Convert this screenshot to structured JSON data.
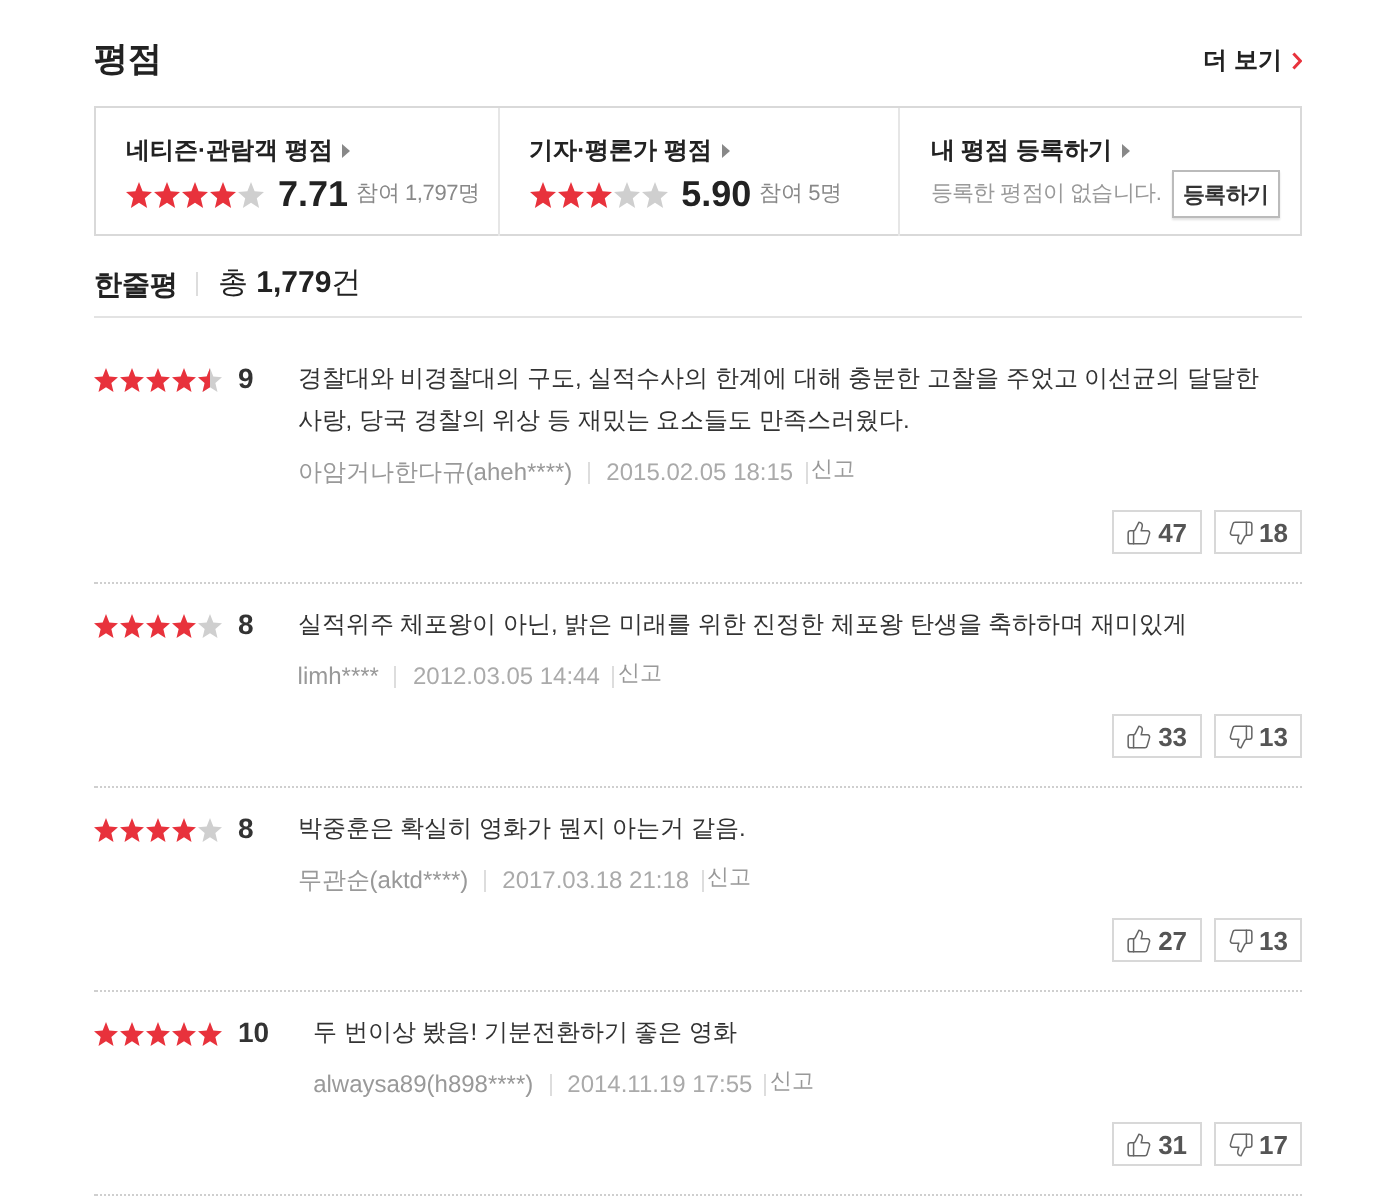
{
  "section": {
    "title": "평점",
    "more_link": "더 보기"
  },
  "summary": [
    {
      "kind": "score",
      "label": "네티즌·관람객 평점",
      "stars": 4,
      "score": "7.71",
      "participants": "참여 1,797명"
    },
    {
      "kind": "score",
      "label": "기자·평론가 평점",
      "stars": 3,
      "score": "5.90",
      "participants": "참여 5명"
    },
    {
      "kind": "register",
      "label": "내 평점 등록하기",
      "message": "등록한 평점이 없습니다.",
      "button": "등록하기"
    }
  ],
  "comments_header": {
    "label": "한줄평",
    "total": "총 **1,779**건"
  },
  "reviews": [
    {
      "stars": 4.5,
      "score": "9",
      "text": "경찰대와 비경찰대의 구도, 실적수사의 한계에 대해 충분한 고찰을 주었고 이선균의 달달한 사랑, 당국 경찰의 위상 등 재밌는 요소들도 만족스러웠다.",
      "author": "아암거나한다규(aheh****)",
      "date": "2015.02.05 18:15",
      "report": "신고",
      "likes": "47",
      "dislikes": "18"
    },
    {
      "stars": 4,
      "score": "8",
      "text": "실적위주 체포왕이 아닌, 밝은 미래를 위한 진정한 체포왕 탄생을 축하하며 재미있게",
      "author": "limh****",
      "date": "2012.03.05 14:44",
      "report": "신고",
      "likes": "33",
      "dislikes": "13"
    },
    {
      "stars": 4,
      "score": "8",
      "text": "박중훈은 확실히 영화가 뭔지 아는거 같음.",
      "author": "무관순(aktd****)",
      "date": "2017.03.18 21:18",
      "report": "신고",
      "likes": "27",
      "dislikes": "13"
    },
    {
      "stars": 5,
      "score": "10",
      "text": "두 번이상 봤음! 기분전환하기 좋은 영화",
      "author": "alwaysa89(h898****)",
      "date": "2014.11.19 17:55",
      "report": "신고",
      "likes": "31",
      "dislikes": "17"
    }
  ]
}
